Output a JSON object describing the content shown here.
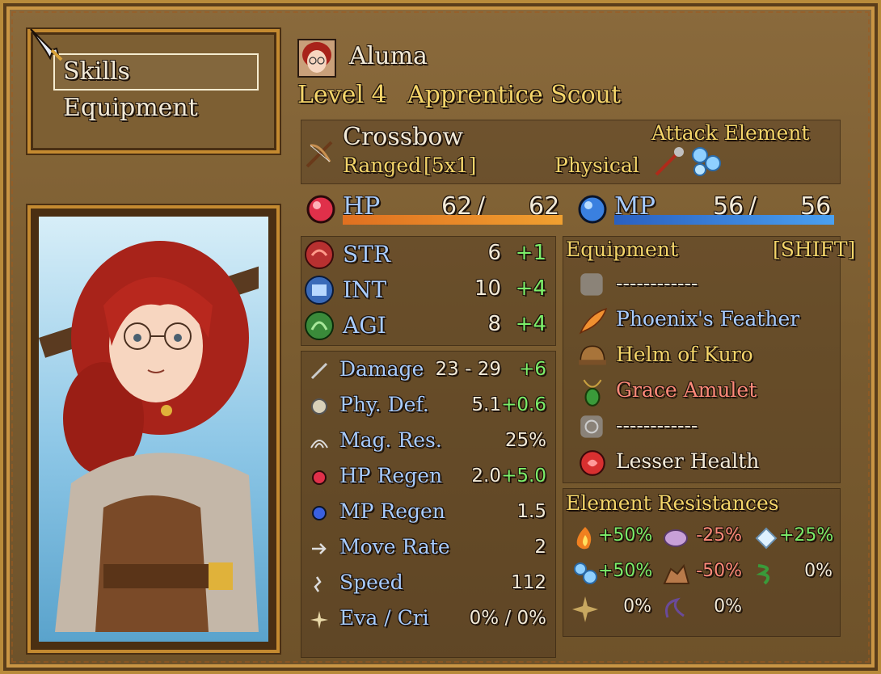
{
  "menu": {
    "items": [
      "Skills",
      "Equipment"
    ],
    "selected_index": 0
  },
  "character": {
    "name": "Aluma",
    "level_label": "Level 4",
    "class": "Apprentice Scout"
  },
  "weapon": {
    "name": "Crossbow",
    "range_label": "Ranged",
    "range_value": "[5x1]",
    "damage_type": "Physical",
    "attack_element_label": "Attack Element"
  },
  "vitals": {
    "hp": {
      "label": "HP",
      "current": "62",
      "separator": "/",
      "max": "62",
      "fill": 1.0
    },
    "mp": {
      "label": "MP",
      "current": "56",
      "separator": "/",
      "max": "56",
      "fill": 1.0
    }
  },
  "attributes": [
    {
      "label": "STR",
      "value": "6",
      "bonus": "+1"
    },
    {
      "label": "INT",
      "value": "10",
      "bonus": "+4"
    },
    {
      "label": "AGI",
      "value": "8",
      "bonus": "+4"
    }
  ],
  "stats": [
    {
      "label": "Damage",
      "value": "23 - 29",
      "bonus": "+6"
    },
    {
      "label": "Phy. Def.",
      "value": "5.1",
      "bonus": "+0.6"
    },
    {
      "label": "Mag. Res.",
      "value": "25%",
      "bonus": ""
    },
    {
      "label": "HP Regen",
      "value": "2.0",
      "bonus": "+5.0"
    },
    {
      "label": "MP Regen",
      "value": "1.5",
      "bonus": ""
    },
    {
      "label": "Move Rate",
      "value": "2",
      "bonus": ""
    },
    {
      "label": "Speed",
      "value": "112",
      "bonus": ""
    },
    {
      "label": "Eva / Cri",
      "value": "0% / 0%",
      "bonus": ""
    }
  ],
  "equipment": {
    "header": "Equipment",
    "shortcut": "[SHIFT]",
    "slots": [
      {
        "name": "------------",
        "color": "#f2ead8"
      },
      {
        "name": "Phoenix's Feather",
        "color": "#a8ccff"
      },
      {
        "name": "Helm of Kuro",
        "color": "#f4d56a"
      },
      {
        "name": "Grace Amulet",
        "color": "#ff8a7a"
      },
      {
        "name": "------------",
        "color": "#f2ead8"
      },
      {
        "name": "Lesser Health",
        "color": "#f2ead8"
      }
    ]
  },
  "resistances": {
    "header": "Element Resistances",
    "items": [
      {
        "icon": "fire-icon",
        "value": "+50%",
        "color": "#7cef6a"
      },
      {
        "icon": "spirit-icon",
        "value": "-25%",
        "color": "#ff8a7a"
      },
      {
        "icon": "ice-icon",
        "value": "+25%",
        "color": "#7cef6a"
      },
      {
        "icon": "water-icon",
        "value": "+50%",
        "color": "#7cef6a"
      },
      {
        "icon": "earth-icon",
        "value": "-50%",
        "color": "#ff8a7a"
      },
      {
        "icon": "wind-icon",
        "value": "0%",
        "color": "#f2ead8"
      },
      {
        "icon": "light-icon",
        "value": "0%",
        "color": "#f2ead8"
      },
      {
        "icon": "dark-icon",
        "value": "0%",
        "color": "#f2ead8"
      }
    ]
  }
}
